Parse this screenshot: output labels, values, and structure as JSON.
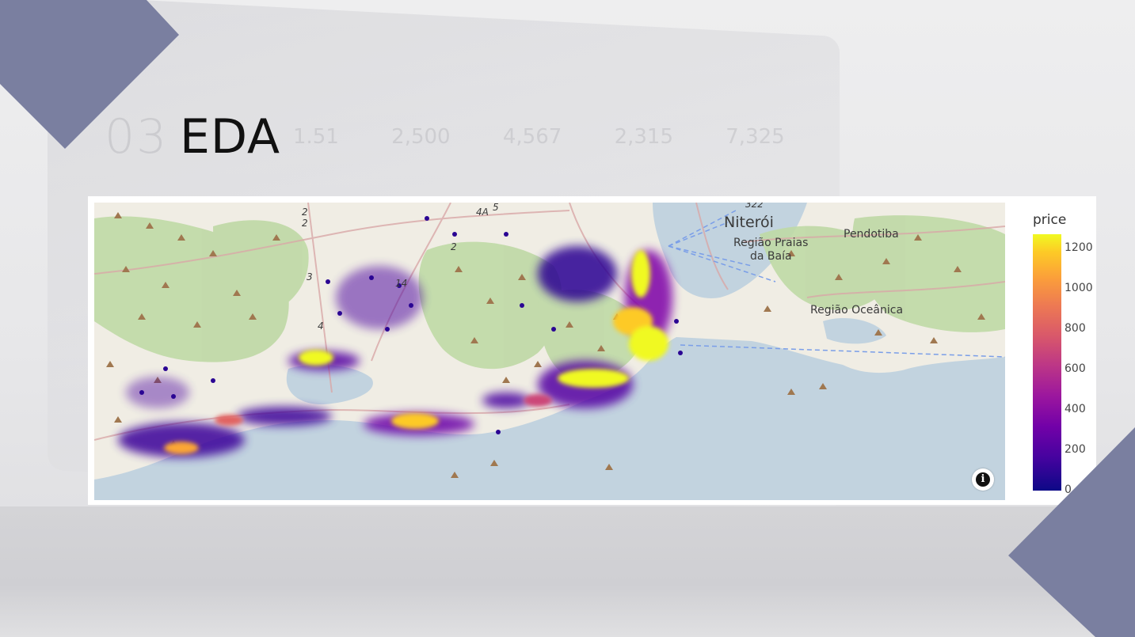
{
  "slide": {
    "title": "EDA",
    "background_number": "03",
    "background_figures": [
      "1.51",
      "2,500",
      "4,567",
      "2,315",
      "7,325"
    ]
  },
  "map": {
    "place_labels": [
      "Niterói",
      "Região Praias",
      "da Baía",
      "Pendotiba",
      "Região Oceânica"
    ],
    "road_labels": [
      "2",
      "2",
      "3",
      "4",
      "14",
      "2",
      "4A",
      "5",
      "322"
    ],
    "info_button_label": "i"
  },
  "legend": {
    "title": "price",
    "ticks": [
      "1200",
      "1000",
      "800",
      "600",
      "400",
      "200",
      "0"
    ],
    "tick_values": [
      1200,
      1000,
      800,
      600,
      400,
      200,
      0
    ],
    "range": [
      0,
      1270
    ],
    "colorscale": "plasma"
  },
  "colors": {
    "accent_shape": "#7a7fa0",
    "water": "#c2d3df",
    "land": "#f0ede4",
    "vegetation": "#bfd9a5",
    "low_density": "#2a0593",
    "high_density": "#f0f921"
  }
}
